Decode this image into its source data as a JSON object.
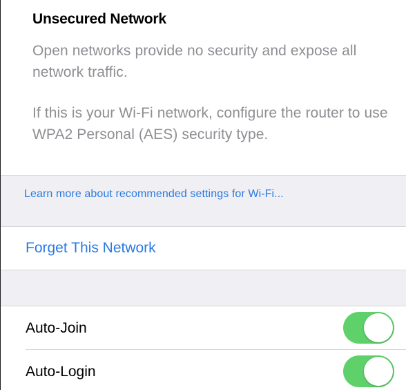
{
  "warning": {
    "title": "Unsecured Network",
    "paragraph1": "Open networks provide no security and expose all network traffic.",
    "paragraph2": "If this is your Wi-Fi network, configure the router to use WPA2 Personal (AES) security type."
  },
  "learn_more": {
    "label": "Learn more about recommended settings for Wi-Fi..."
  },
  "forget": {
    "label": "Forget This Network"
  },
  "toggles": [
    {
      "label": "Auto-Join",
      "on": true
    },
    {
      "label": "Auto-Login",
      "on": true
    }
  ],
  "colors": {
    "accent": "#2a7ae2",
    "switch_on": "#5fd16b",
    "secondary_text": "#8e8e93",
    "group_background": "#efeff4"
  }
}
